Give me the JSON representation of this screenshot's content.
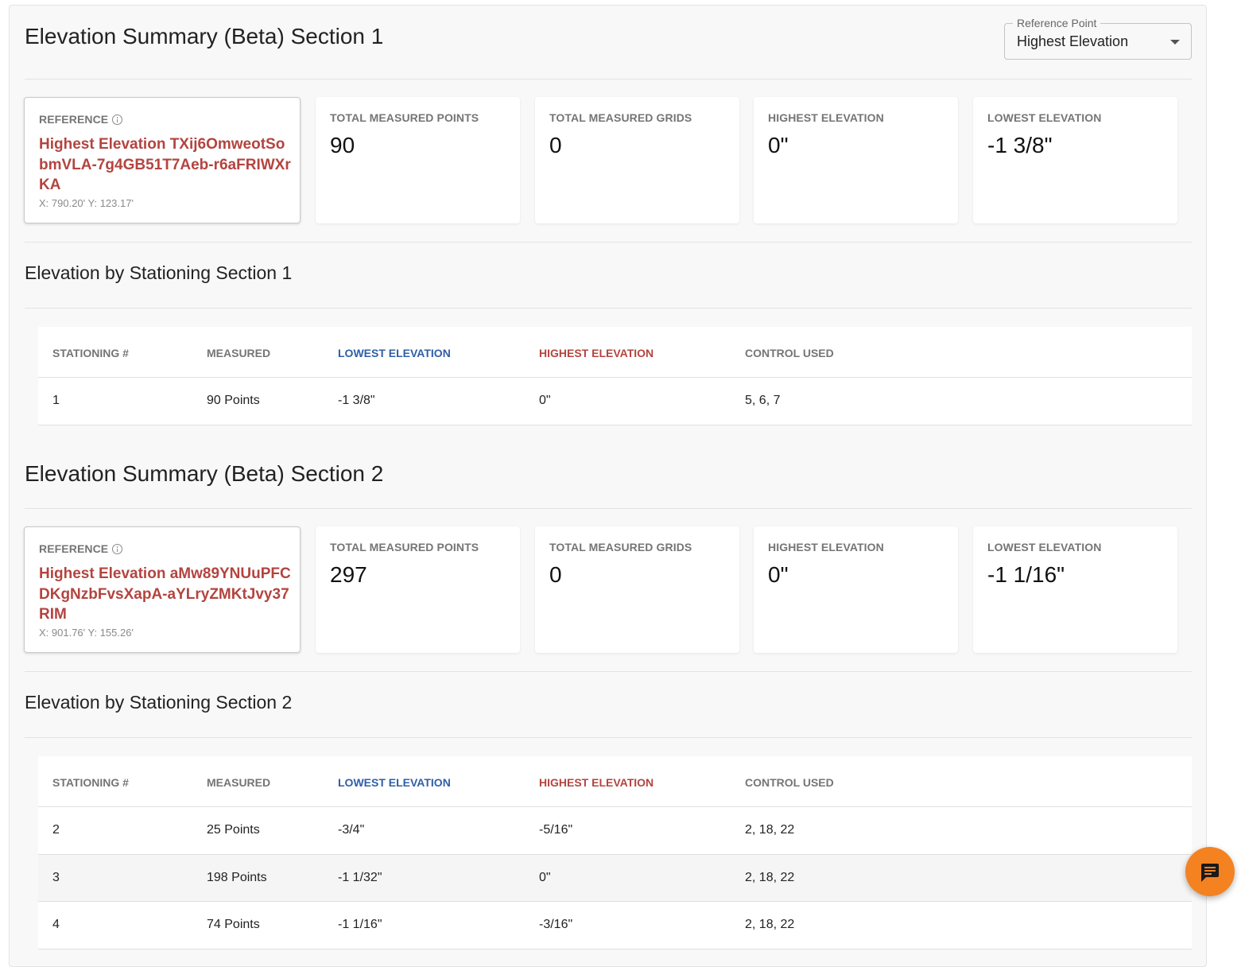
{
  "reference_select": {
    "legend": "Reference Point",
    "value": "Highest Elevation"
  },
  "sections": [
    {
      "title": "Elevation Summary (Beta) Section 1",
      "reference": {
        "label": "REFERENCE",
        "name": "Highest Elevation TXij6OmweotSobmVLA-7g4GB51T7Aeb-r6aFRIWXrKA",
        "coords": "X: 790.20' Y: 123.17'"
      },
      "stats": [
        {
          "label": "TOTAL MEASURED POINTS",
          "value": "90"
        },
        {
          "label": "TOTAL MEASURED GRIDS",
          "value": "0"
        },
        {
          "label": "HIGHEST ELEVATION",
          "value": "0\""
        },
        {
          "label": "LOWEST ELEVATION",
          "value": "-1 3/8\""
        }
      ],
      "stationing_title": "Elevation by Stationing Section 1",
      "table": {
        "headers": [
          "STATIONING #",
          "MEASURED",
          "LOWEST ELEVATION",
          "HIGHEST ELEVATION",
          "CONTROL USED"
        ],
        "rows": [
          [
            "1",
            "90 Points",
            "-1 3/8\"",
            "0\"",
            "5, 6, 7"
          ]
        ]
      }
    },
    {
      "title": "Elevation Summary (Beta) Section 2",
      "reference": {
        "label": "REFERENCE",
        "name": "Highest Elevation aMw89YNUuPFCDKgNzbFvsXapA-aYLryZMKtJvy37RIM",
        "coords": "X: 901.76' Y: 155.26'"
      },
      "stats": [
        {
          "label": "TOTAL MEASURED POINTS",
          "value": "297"
        },
        {
          "label": "TOTAL MEASURED GRIDS",
          "value": "0"
        },
        {
          "label": "HIGHEST ELEVATION",
          "value": "0\""
        },
        {
          "label": "LOWEST ELEVATION",
          "value": "-1 1/16\""
        }
      ],
      "stationing_title": "Elevation by Stationing Section 2",
      "table": {
        "headers": [
          "STATIONING #",
          "MEASURED",
          "LOWEST ELEVATION",
          "HIGHEST ELEVATION",
          "CONTROL USED"
        ],
        "rows": [
          [
            "2",
            "25 Points",
            "-3/4\"",
            "-5/16\"",
            "2, 18, 22"
          ],
          [
            "3",
            "198 Points",
            "-1 1/32\"",
            "0\"",
            "2, 18, 22"
          ],
          [
            "4",
            "74 Points",
            "-1 1/16\"",
            "-3/16\"",
            "2, 18, 22"
          ]
        ]
      }
    }
  ],
  "icons": {
    "info": "info-icon",
    "dropdown": "caret-down-icon",
    "chat": "chat-icon"
  },
  "colors": {
    "accent_red": "#b3443f",
    "accent_blue": "#2f5ea8",
    "fab_orange": "#f58220"
  }
}
